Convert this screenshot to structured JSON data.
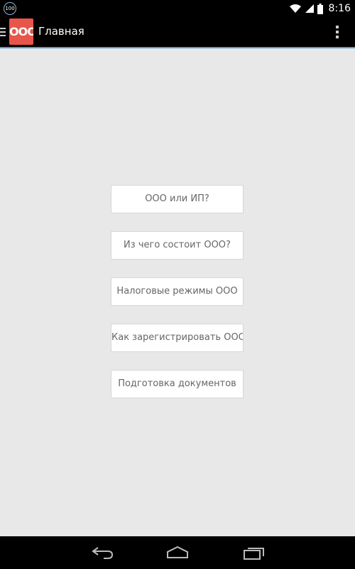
{
  "status_bar": {
    "notification_badge": "100",
    "time": "8:16",
    "icons": [
      "wifi-icon",
      "signal-icon",
      "battery-icon"
    ]
  },
  "action_bar": {
    "logo_text": "OOO",
    "title": "Главная",
    "accent_color": "#e8554a",
    "underline_color": "#4a9fd0"
  },
  "main": {
    "buttons": [
      {
        "label": "ООО или ИП?"
      },
      {
        "label": "Из чего состоит ООО?"
      },
      {
        "label": "Налоговые режимы ООО"
      },
      {
        "label": "Как зарегистрировать ООО"
      },
      {
        "label": "Подготовка документов"
      }
    ]
  },
  "nav_bar": {
    "icons": [
      "back-icon",
      "home-icon",
      "recents-icon"
    ]
  }
}
